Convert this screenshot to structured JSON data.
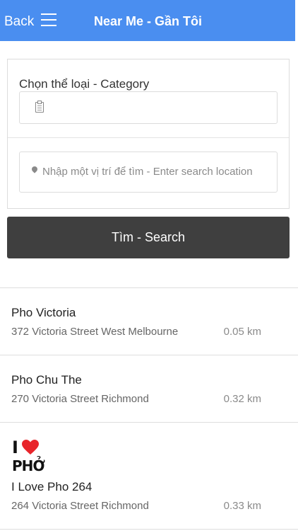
{
  "nav": {
    "back_label": "Back",
    "title": "Near Me - Gần Tôi"
  },
  "filter": {
    "category_label": "Chọn thể loại - Category",
    "category_value": "",
    "location_placeholder": "Nhập một vị trí để tìm - Enter search location",
    "search_label": "Tìm - Search"
  },
  "results": [
    {
      "name": "Pho Victoria",
      "address": "372 Victoria Street West Melbourne",
      "distance": "0.05 km"
    },
    {
      "name": "Pho Chu The",
      "address": "270 Victoria Street Richmond",
      "distance": "0.32 km"
    },
    {
      "name": "I Love Pho 264",
      "address": "264 Victoria Street Richmond",
      "distance": "0.33 km",
      "logo": {
        "line1": "I",
        "line2": "PHỞ"
      }
    }
  ],
  "colors": {
    "nav_bg": "#4a8ef0",
    "button_bg": "#3f3f3f",
    "heart": "#e8252b"
  }
}
